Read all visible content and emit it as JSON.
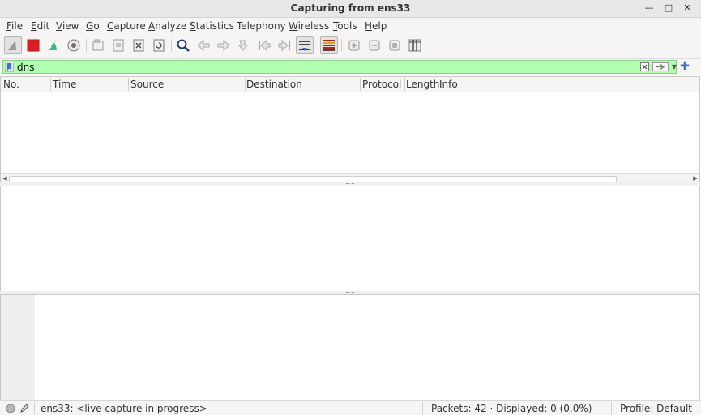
{
  "window": {
    "title": "Capturing from ens33"
  },
  "menu": [
    {
      "label": "File",
      "mnemonic": "F",
      "rest": "ile"
    },
    {
      "label": "Edit",
      "mnemonic": "E",
      "rest": "dit"
    },
    {
      "label": "View",
      "mnemonic": "V",
      "rest": "iew"
    },
    {
      "label": "Go",
      "mnemonic": "G",
      "rest": "o"
    },
    {
      "label": "Capture",
      "mnemonic": "C",
      "rest": "apture"
    },
    {
      "label": "Analyze",
      "mnemonic": "A",
      "rest": "nalyze"
    },
    {
      "label": "Statistics",
      "mnemonic": "S",
      "rest": "tatistics"
    },
    {
      "label": "Telephony",
      "mnemonic": "",
      "rest": "Telephony"
    },
    {
      "label": "Wireless",
      "mnemonic": "W",
      "rest": "ireless"
    },
    {
      "label": "Tools",
      "mnemonic": "T",
      "rest": "ools"
    },
    {
      "label": "Help",
      "mnemonic": "H",
      "rest": "elp"
    }
  ],
  "filter": {
    "value": "dns"
  },
  "packet_list": {
    "columns": [
      "No.",
      "Time",
      "Source",
      "Destination",
      "Protocol",
      "Length",
      "Info"
    ],
    "rows": []
  },
  "status": {
    "interface": "ens33: <live capture in progress>",
    "packets": "Packets: 42 · Displayed: 0 (0.0%)",
    "profile": "Profile: Default"
  },
  "colors": {
    "filter_valid_bg": "#afffaf",
    "stop_red": "#e01b24",
    "restart_green": "#2ec27e",
    "accent_blue": "#3e6fd6"
  }
}
